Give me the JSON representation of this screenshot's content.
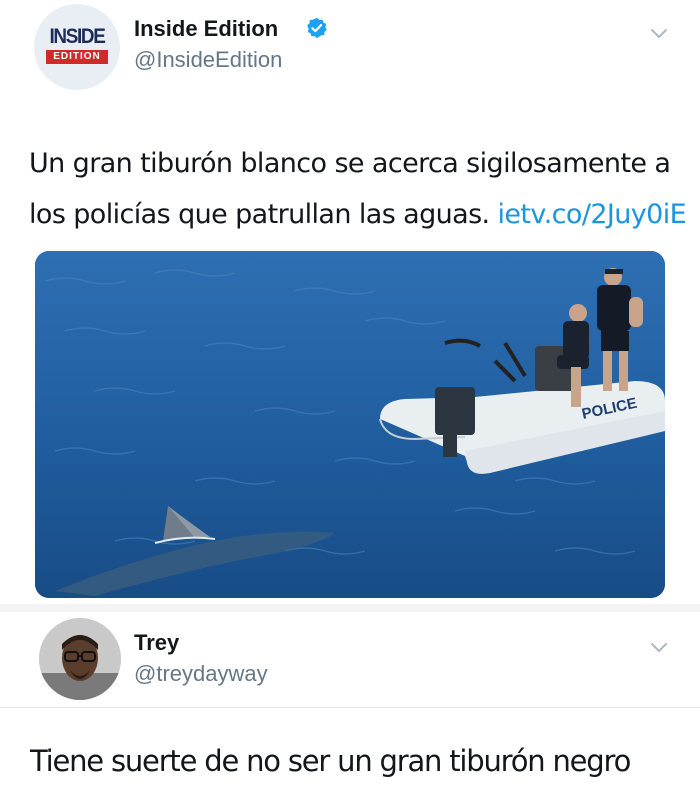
{
  "tweet": {
    "author_name": "Inside Edition",
    "author_handle": "@InsideEdition",
    "logo_top": "INSIDE",
    "logo_bottom": "EDITION",
    "text_line1": "Un gran tiburón blanco se acerca sigilosamente a",
    "text_line2": "los policías que patrullan las aguas.",
    "link": "ietv.co/2Juy0iE",
    "media_boat_label": "POLICE",
    "verified_color": "#1da1f2"
  },
  "reply": {
    "author_name": "Trey",
    "author_handle": "@treydayway",
    "text": "Tiene suerte de no ser un gran tiburón negro"
  },
  "icons": {
    "menu": "chevron-down-icon",
    "verified": "verified-badge-icon"
  }
}
